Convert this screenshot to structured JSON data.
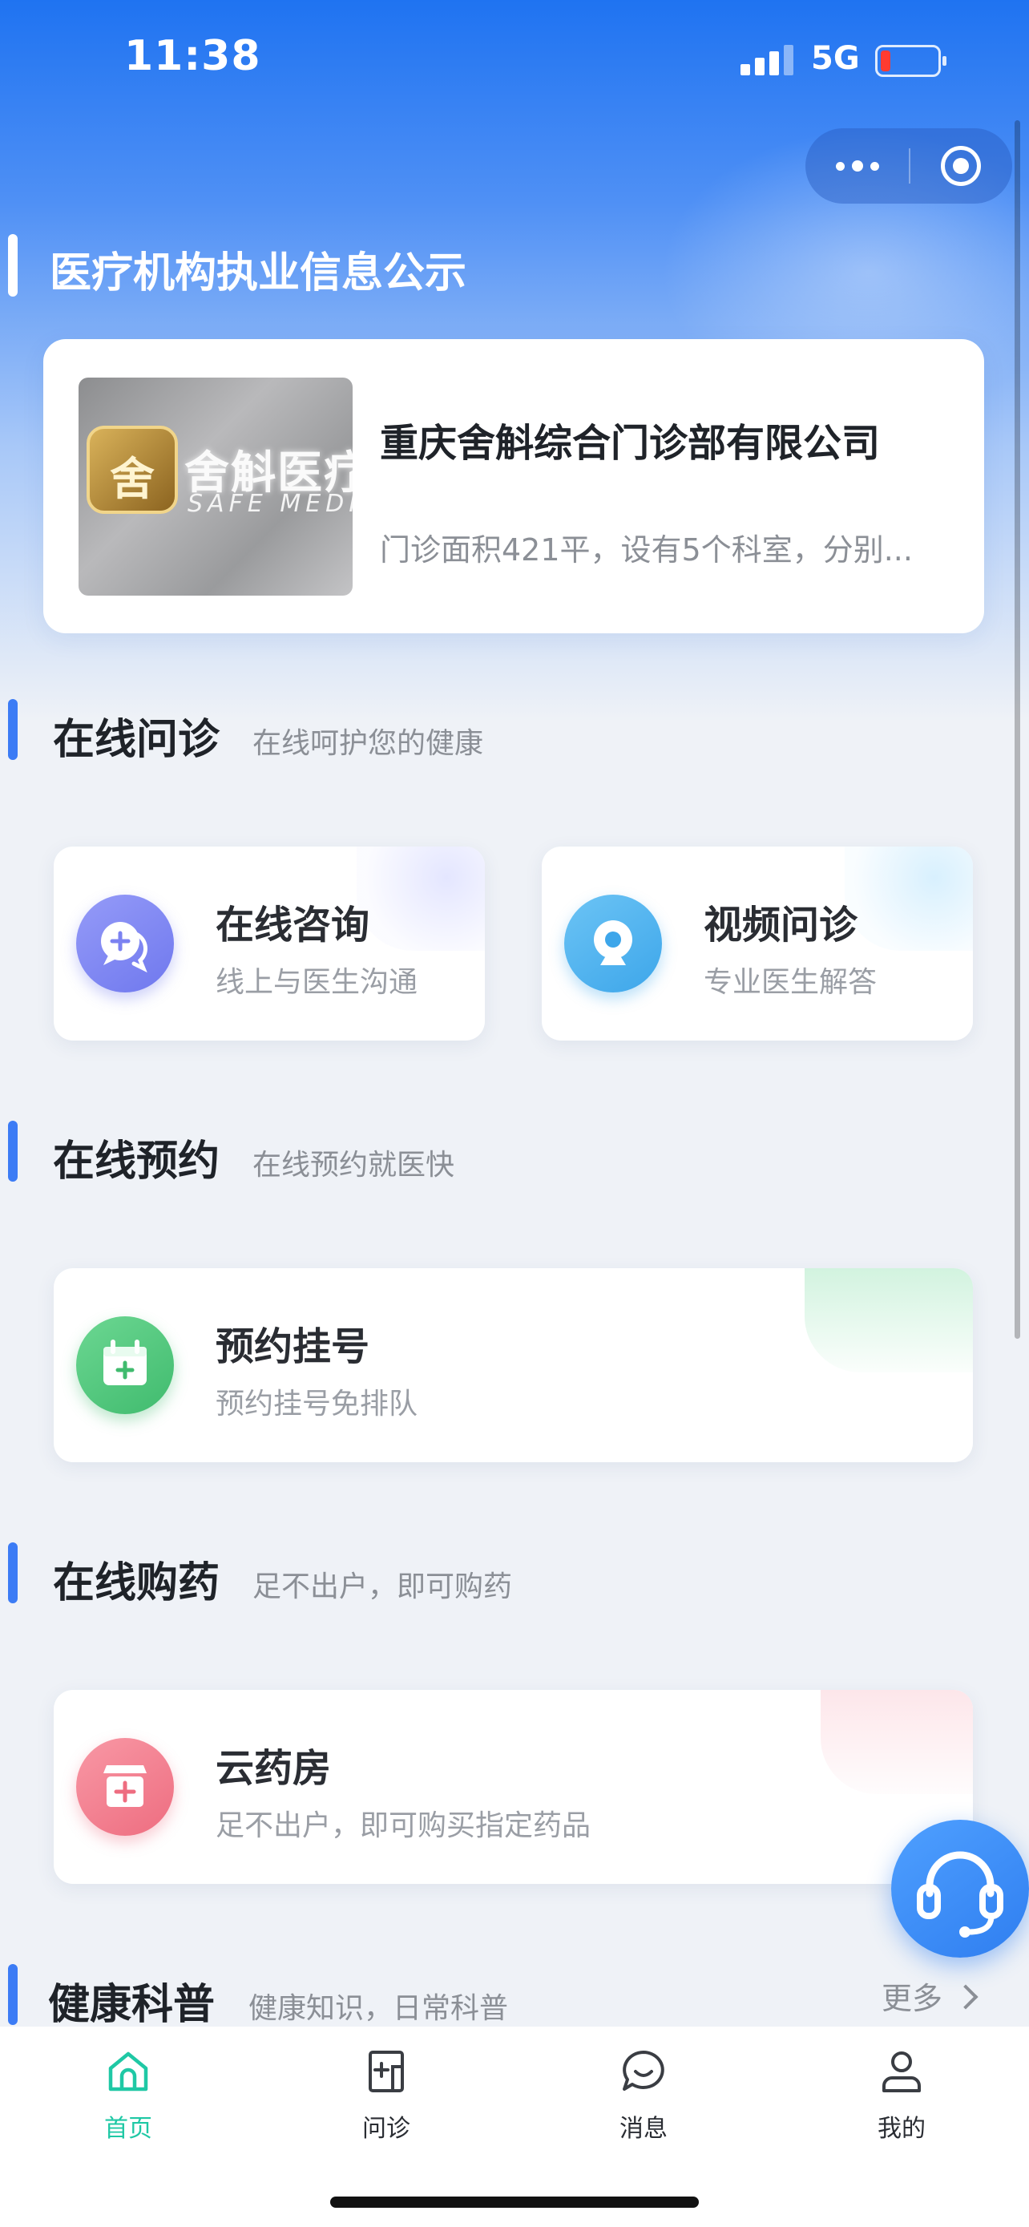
{
  "status_bar": {
    "time": "11:38",
    "network": "5G"
  },
  "hero": {
    "title": "医疗机构执业信息公示"
  },
  "institution": {
    "name": "重庆舍斛综合门诊部有限公司",
    "description": "门诊面积421平，设有5个科室，分别...",
    "image_sign_cn": "舍斛医疗",
    "image_sign_en": "SAFE MEDICAL",
    "image_logo_char": "舍"
  },
  "sections": {
    "consult": {
      "title": "在线问诊",
      "subtitle": "在线呵护您的健康",
      "cards": [
        {
          "title": "在线咨询",
          "subtitle": "线上与医生沟通",
          "icon": "chat-icon"
        },
        {
          "title": "视频问诊",
          "subtitle": "专业医生解答",
          "icon": "webcam-icon"
        }
      ]
    },
    "booking": {
      "title": "在线预约",
      "subtitle": "在线预约就医快",
      "card": {
        "title": "预约挂号",
        "subtitle": "预约挂号免排队",
        "icon": "calendar-plus-icon"
      }
    },
    "pharmacy": {
      "title": "在线购药",
      "subtitle": "足不出户，即可购药",
      "card": {
        "title": "云药房",
        "subtitle": "足不出户，即可购买指定药品",
        "icon": "pharmacy-store-icon"
      }
    },
    "health": {
      "title": "健康科普",
      "subtitle": "健康知识，日常科普",
      "more_label": "更多"
    }
  },
  "tabbar": {
    "items": [
      {
        "label": "首页",
        "icon": "home-icon",
        "active": true
      },
      {
        "label": "问诊",
        "icon": "medical-doc-icon",
        "active": false
      },
      {
        "label": "消息",
        "icon": "message-icon",
        "active": false
      },
      {
        "label": "我的",
        "icon": "user-icon",
        "active": false
      }
    ]
  },
  "colors": {
    "accent_blue": "#3c7cf5",
    "active_tab": "#1fc8a5",
    "consult_icon": "#7f86f3",
    "video_icon": "#4fb2ee",
    "booking_icon": "#4cc77d",
    "pharmacy_icon": "#f17b8b"
  }
}
